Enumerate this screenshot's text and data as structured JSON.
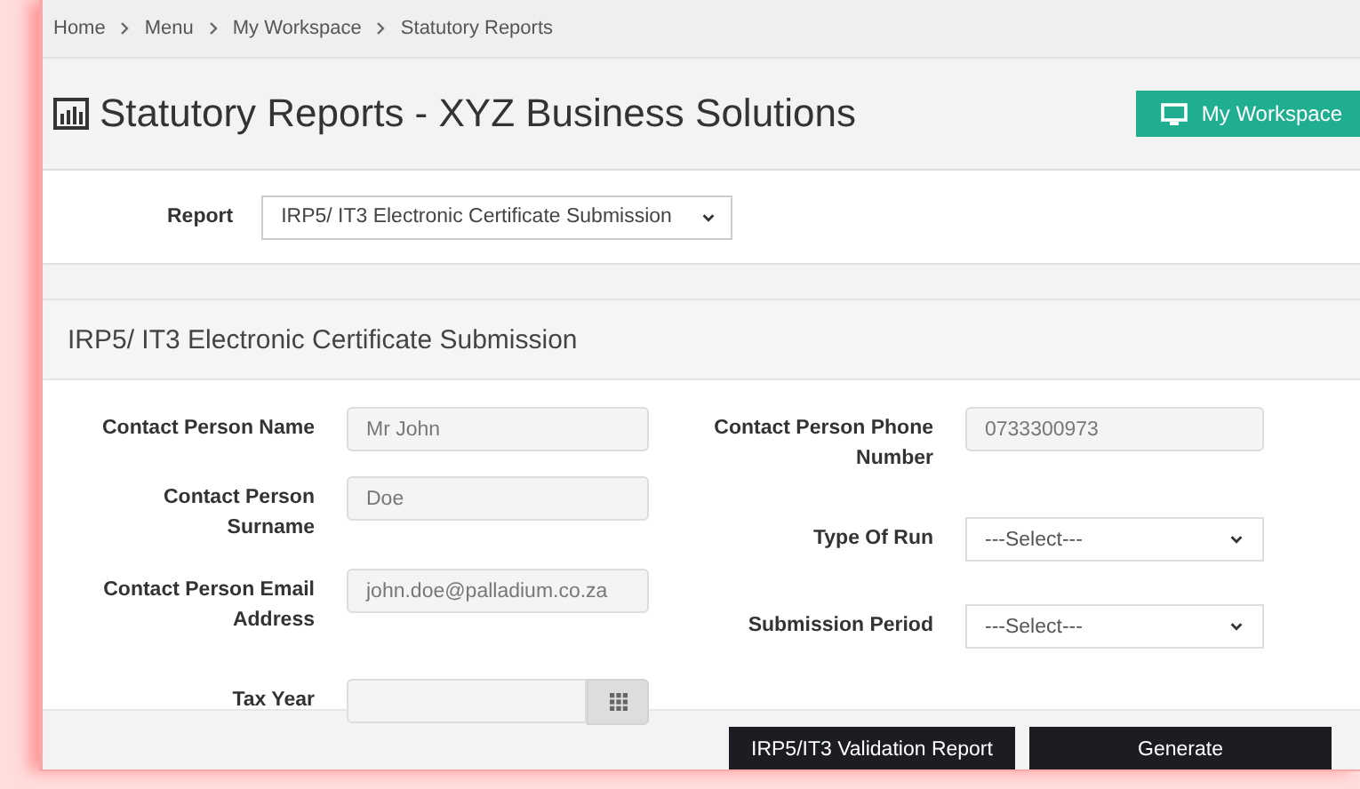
{
  "breadcrumb": [
    {
      "label": "Home"
    },
    {
      "label": "Menu"
    },
    {
      "label": "My Workspace"
    },
    {
      "label": "Statutory Reports"
    }
  ],
  "page_title": "Statutory Reports - XYZ Business Solutions",
  "workspace_button": "My Workspace",
  "report": {
    "label": "Report",
    "value": "IRP5/ IT3 Electronic Certificate Submission"
  },
  "section_title": "IRP5/ IT3 Electronic Certificate Submission",
  "left_fields": [
    {
      "kind": "text",
      "label": "Contact Person Name",
      "value": "Mr John"
    },
    {
      "kind": "text",
      "label": "Contact Person Surname",
      "value": "Doe"
    },
    {
      "kind": "text",
      "label": "Contact Person Email Address",
      "value": "john.doe@palladium.co.za"
    },
    {
      "kind": "date",
      "label": "Tax Year"
    }
  ],
  "right_fields": [
    {
      "kind": "text",
      "label": "Contact Person Phone Number",
      "value": "0733300973"
    },
    {
      "kind": "select",
      "label": "Type Of Run",
      "value": "---Select---"
    },
    {
      "kind": "select",
      "label": "Submission Period",
      "value": "---Select---"
    }
  ],
  "buttons": [
    "IRP5/IT3 Validation Report",
    "Generate"
  ]
}
